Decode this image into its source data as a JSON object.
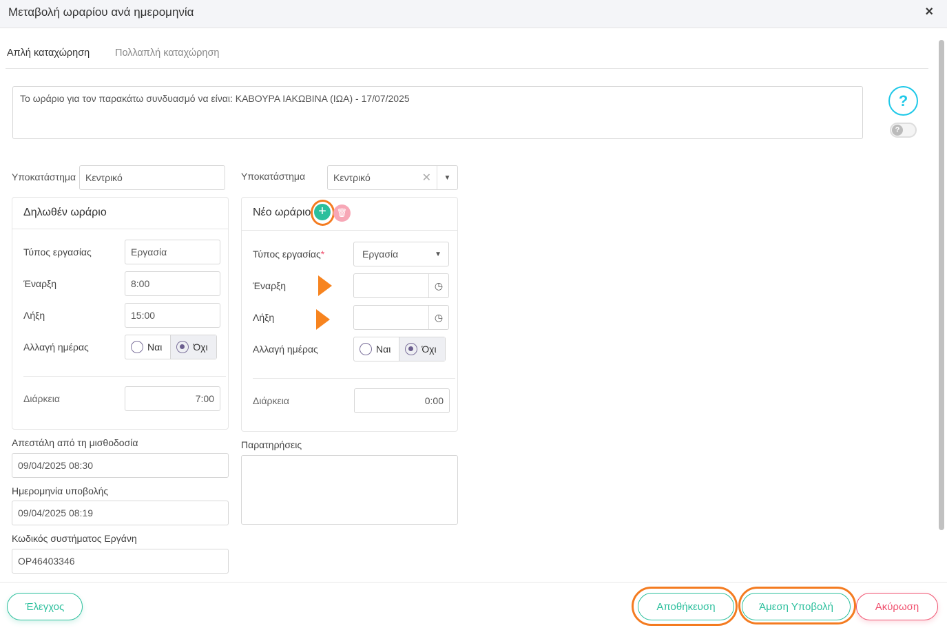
{
  "header": {
    "title": "Μεταβολή ωραρίου ανά ημερομηνία",
    "close": "×"
  },
  "tabs": [
    {
      "label": "Απλή καταχώρηση",
      "active": true
    },
    {
      "label": "Πολλαπλή καταχώρηση",
      "active": false
    }
  ],
  "info_text": "Το ωράριο για τον παρακάτω συνδυασμό να είναι: ΚΑΒΟΥΡΑ ΙΑΚΩΒΙΝΑ (ΙΩΑ) - 17/07/2025",
  "help": {
    "icon": "question-icon",
    "label": "?"
  },
  "left": {
    "branch_label": "Υποκατάστημα",
    "branch_value": "Κεντρικό",
    "panel_title": "Δηλωθέν ωράριο",
    "work_type_label": "Τύπος εργασίας",
    "work_type_value": "Εργασία",
    "start_label": "Έναρξη",
    "start_value": "8:00",
    "end_label": "Λήξη",
    "end_value": "15:00",
    "day_change_label": "Αλλαγή ημέρας",
    "yes": "Ναι",
    "no": "Όχι",
    "duration_label": "Διάρκεια",
    "duration_value": "7:00",
    "sent_label": "Απεστάλη από τη μισθοδοσία",
    "sent_value": "09/04/2025 08:30",
    "submit_date_label": "Ημερομηνία υποβολής",
    "submit_date_value": "09/04/2025 08:19",
    "ergani_label": "Κωδικός συστήματος Εργάνη",
    "ergani_value": "ΟΡ46403346"
  },
  "right": {
    "branch_label": "Υποκατάστημα",
    "branch_value": "Κεντρικό",
    "panel_title": "Νέο ωράριο",
    "work_type_label": "Τύπος εργασίας",
    "required": "*",
    "work_type_value": "Εργασία",
    "start_label": "Έναρξη",
    "start_value": "",
    "end_label": "Λήξη",
    "end_value": "",
    "day_change_label": "Αλλαγή ημέρας",
    "yes": "Ναι",
    "no": "Όχι",
    "duration_label": "Διάρκεια",
    "duration_value": "0:00",
    "notes_label": "Παρατηρήσεις",
    "notes_value": ""
  },
  "footer": {
    "check": "Έλεγχος",
    "save": "Αποθήκευση",
    "submit": "Άμεση Υποβολή",
    "cancel": "Ακύρωση"
  },
  "colors": {
    "accent": "#2bbf9c",
    "danger": "#f0506e",
    "annotation": "#f47b20",
    "help": "#1ec8e8"
  }
}
